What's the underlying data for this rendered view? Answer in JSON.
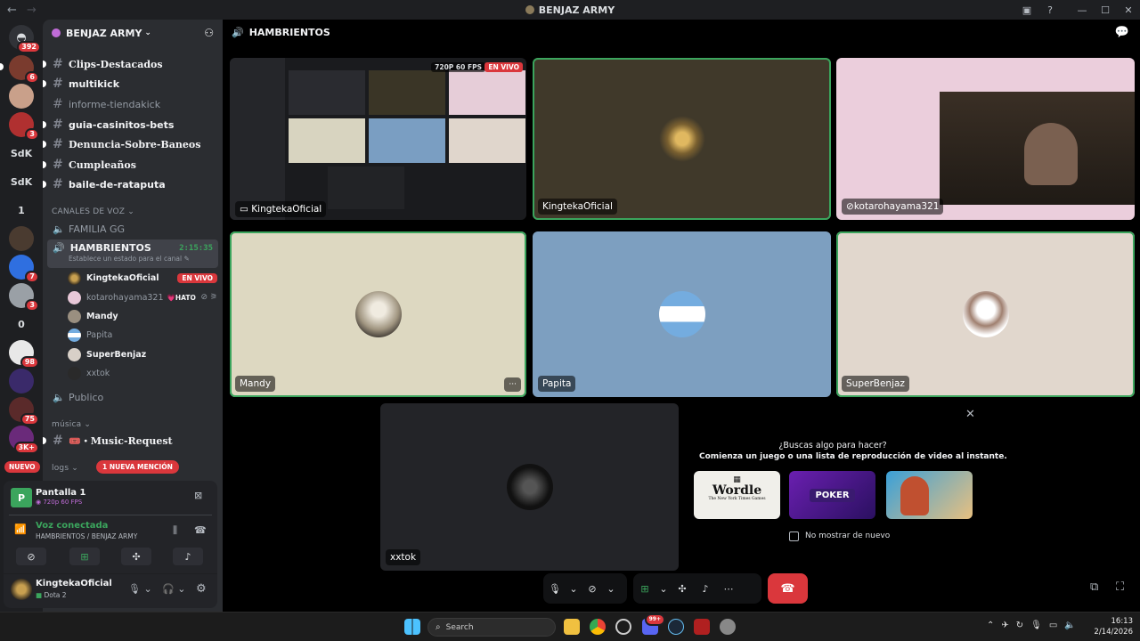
{
  "window": {
    "title": "BENJAZ ARMY",
    "back": "←",
    "forward": "→"
  },
  "rail": {
    "badges": {
      "dms": "392",
      "s1": "6",
      "s3": "3",
      "s9": "7",
      "s10": "3",
      "s12": "98",
      "s14": "75",
      "s15": "3K+"
    },
    "labels": {
      "sdk1": "SdK",
      "sdk2": "SdK",
      "one": "1",
      "zero": "0"
    },
    "new_label": "NUEVO"
  },
  "sidebar": {
    "guild_name": "BENJAZ ARMY",
    "channels": [
      {
        "name": "Clips-Destacados"
      },
      {
        "name": "multikick"
      },
      {
        "name": "informe-tiendakick"
      },
      {
        "name": "guia-casinitos-bets"
      },
      {
        "name": "Denuncia-Sobre-Baneos"
      },
      {
        "name": "Cumpleaños"
      },
      {
        "name": "baile-de-rataputa"
      }
    ],
    "voice_category": "CANALES DE VOZ",
    "voice_channels": {
      "familia": "FAMILIA GG",
      "hambrientos": "HAMBRIENTOS",
      "hambrientos_timer": "2:15:35",
      "hambrientos_status": "Establece un estado para el canal",
      "publico": "Publico"
    },
    "voice_users": [
      {
        "name": "KingtekaOficial",
        "badge": "EN VIVO"
      },
      {
        "name": "kotarohayama321",
        "tag": "💗HATO"
      },
      {
        "name": "Mandy"
      },
      {
        "name": "Papita"
      },
      {
        "name": "SuperBenjaz"
      },
      {
        "name": "xxtok"
      }
    ],
    "music_category": "música",
    "music_channel": "🎟️・Music-Request",
    "logs_category": "logs",
    "mention_pill": "1 NUEVA MENCIÓN"
  },
  "panel": {
    "stream_title": "Pantalla 1",
    "stream_quality": "720p 60 FPS",
    "voice_status": "Voz conectada",
    "voice_location": "HAMBRIENTOS / BENJAZ ARMY",
    "username": "KingtekaOficial",
    "activity": "Dota 2"
  },
  "call": {
    "channel": "HAMBRIENTOS",
    "quality_badge": "720P 60 FPS",
    "live_badge": "EN VIVO",
    "tiles": [
      {
        "name": "KingtekaOficial"
      },
      {
        "name": "KingtekaOficial"
      },
      {
        "name": "kotarohayama321"
      },
      {
        "name": "Mandy"
      },
      {
        "name": "Papita"
      },
      {
        "name": "SuperBenjaz"
      },
      {
        "name": "xxtok"
      }
    ],
    "promo": {
      "title": "¿Buscas algo para hacer?",
      "subtitle": "Comienza un juego o una lista de reproducción de video al instante.",
      "games": [
        "Wordle",
        "POKER",
        ""
      ],
      "wordle_sub": "The New York Times Games",
      "dont_show": "No mostrar de nuevo"
    },
    "more_label": "···"
  },
  "taskbar": {
    "search_placeholder": "Search",
    "time": "16:13",
    "date": "2/14/2026",
    "discord_badge": "99+"
  },
  "colors": {
    "accent_green": "#3ba55d",
    "live_red": "#da373c",
    "hangup_red": "#da373c",
    "mention_red": "#da373c"
  }
}
